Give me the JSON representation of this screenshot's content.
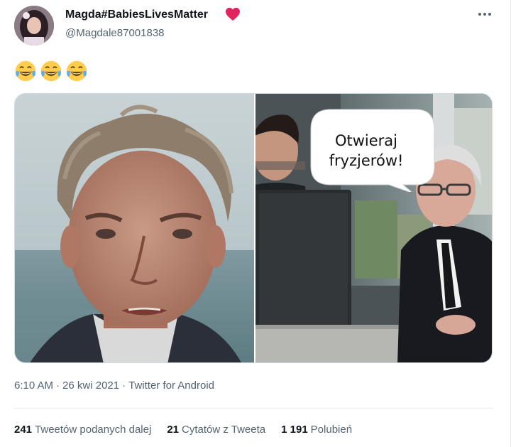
{
  "tweet": {
    "author": {
      "name": "Magda#BabiesLivesMatter",
      "handle": "@Magdale87001838",
      "avatar_icon": "profile-photo"
    },
    "emojis": [
      "face-with-tears-of-joy",
      "face-with-tears-of-joy",
      "face-with-tears-of-joy"
    ],
    "media": {
      "bubble_line1": "Otwieraj",
      "bubble_line2": "fryzjerów!"
    },
    "meta": {
      "time": "6:10 AM",
      "date": "26 kwi 2021",
      "app": "Twitter for Android",
      "separator": "·"
    },
    "stats": {
      "retweets": {
        "count": "241",
        "label": "Tweetów podanych dalej"
      },
      "quotes": {
        "count": "21",
        "label": "Cytatów z Tweeta"
      },
      "likes": {
        "count": "1 191",
        "label": "Polubień"
      }
    }
  },
  "colors": {
    "heart": "#e0245e",
    "secondary_text": "#536471",
    "divider": "#e6ecf0"
  }
}
